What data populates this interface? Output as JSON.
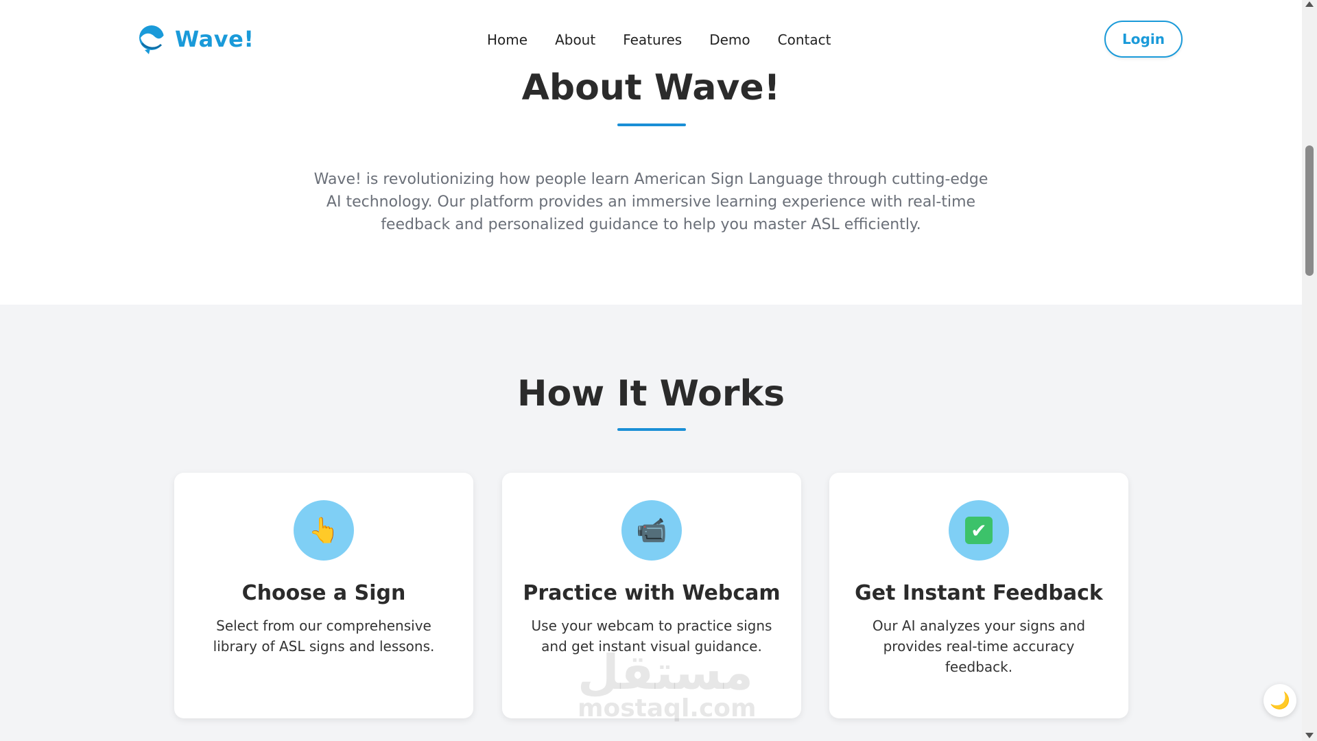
{
  "header": {
    "brand": "Wave!",
    "nav": [
      "Home",
      "About",
      "Features",
      "Demo",
      "Contact"
    ],
    "login_label": "Login"
  },
  "about": {
    "title": "About Wave!",
    "text": "Wave! is revolutionizing how people learn American Sign Language through cutting-edge AI technology. Our platform provides an immersive learning experience with real-time feedback and personalized guidance to help you master ASL efficiently."
  },
  "how_it_works": {
    "title": "How It Works",
    "cards": [
      {
        "icon": "pointing-hand-icon",
        "glyph": "👆",
        "title": "Choose a Sign",
        "desc": "Select from our comprehensive library of ASL signs and lessons."
      },
      {
        "icon": "video-camera-icon",
        "glyph": "📹",
        "title": "Practice with Webcam",
        "desc": "Use your webcam to practice signs and get instant visual guidance."
      },
      {
        "icon": "check-mark-icon",
        "glyph": "✔",
        "title": "Get Instant Feedback",
        "desc": "Our AI analyzes your signs and provides real-time accuracy feedback."
      }
    ]
  },
  "watermark": {
    "arabic": "مستقل",
    "latin": "mostaql.com"
  },
  "theme_toggle": {
    "icon": "moon-icon",
    "glyph": "🌙"
  },
  "colors": {
    "accent": "#1a9ad9",
    "icon_bg": "#7fcff5",
    "section_bg": "#f3f4f6"
  }
}
